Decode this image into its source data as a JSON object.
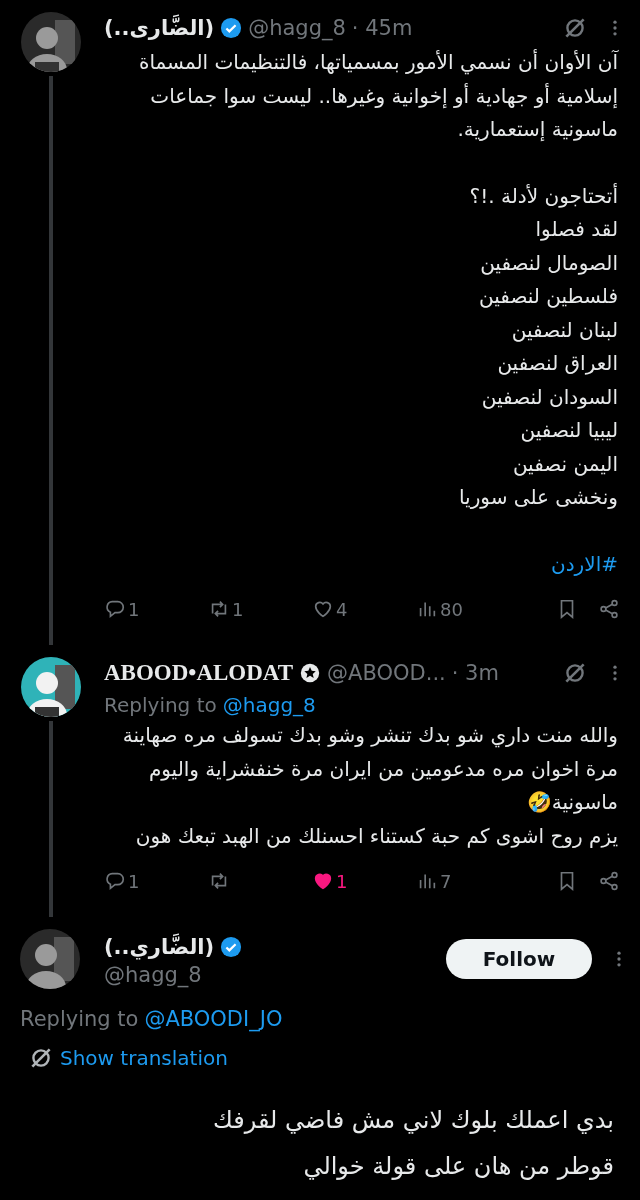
{
  "thread": [
    {
      "name": "(الضَّارى..)",
      "badge": {
        "kind": "verified"
      },
      "handle": "@hagg_8",
      "time": "· 45m",
      "paragraphs": [
        [
          "آن الأوان أن نسمي الأمور بمسمياتها، فالتنظيمات المسماة",
          "إسلامية أو جهادية أو إخوانية وغيرها.. ليست سوا جماعات",
          "ماسونية إستعمارية."
        ],
        [
          "أتحتاجون لأدلة .!؟",
          "لقد فصلوا",
          "الصومال لنصفين",
          "فلسطين لنصفين",
          "لبنان لنصفين",
          "العراق لنصفين",
          "السودان لنصفين",
          "ليبيا لنصفين",
          "اليمن نصفين",
          "ونخشى على سوريا"
        ]
      ],
      "hashtag": "#الاردن",
      "actions": {
        "replies": "1",
        "reposts": "1",
        "likes": "4",
        "views": "80",
        "liked": false
      }
    },
    {
      "name": "ABOOD•ALODAT",
      "badge": {
        "kind": "star"
      },
      "handle": "@ABOOD...",
      "time": "· 3m",
      "replying_label": "Replying to",
      "replying_to": "@hagg_8",
      "paragraphs": [
        [
          "والله منت داري شو بدك تنشر وشو بدك تسولف مره صهاينة",
          "مرة اخوان مره مدعومين من ايران مرة خنفشراية واليوم",
          "ماسونية🤣",
          "يزم روح اشوى كم حبة كستناء احسنلك من الهبد تبعك هون"
        ]
      ],
      "actions": {
        "replies": "1",
        "likes": "1",
        "views": "7",
        "liked": true
      }
    }
  ],
  "focused": {
    "name": "(الضَّاري..)",
    "badge": {
      "kind": "verified"
    },
    "handle": "@hagg_8",
    "follow": "Follow",
    "replying_label": "Replying to",
    "replying_to": "@ABOODI_JO",
    "translate": "Show translation",
    "lines": [
      "بدي اعملك بلوك لاني مش فاضي لقرفك",
      "قوطر من هان على قولة خوالي"
    ]
  }
}
